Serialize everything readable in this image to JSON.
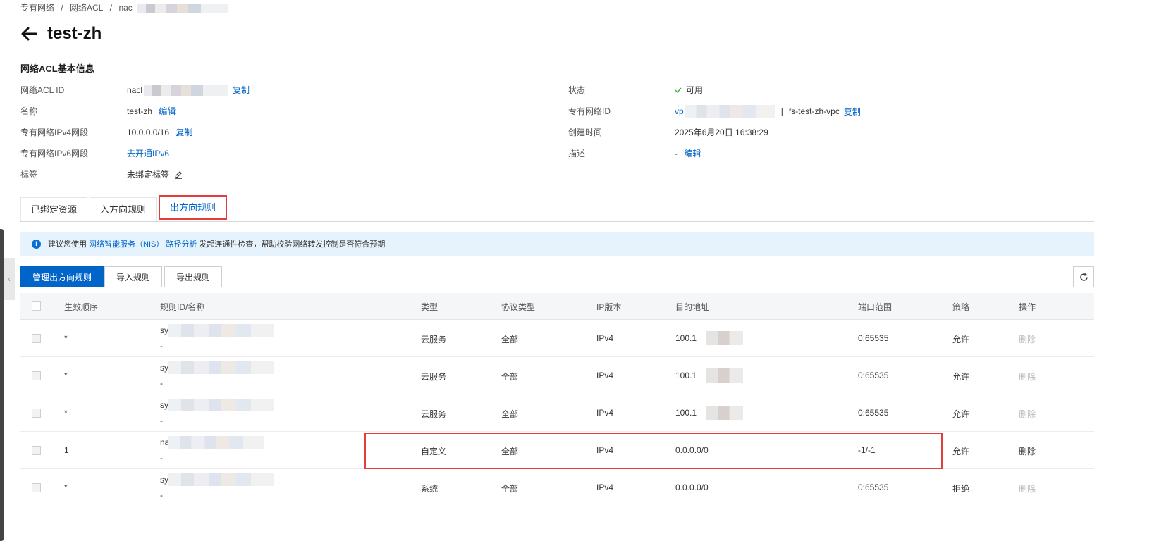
{
  "breadcrumb": [
    "专有网络",
    "/",
    "网络ACL",
    "/",
    "nac"
  ],
  "page_title": "test-zh",
  "section_title": "网络ACL基本信息",
  "left_info": [
    {
      "label": "网络ACL ID",
      "value": "nacl",
      "action": "复制"
    },
    {
      "label": "名称",
      "value": "test-zh",
      "action": "编辑"
    },
    {
      "label": "专有网络IPv4网段",
      "value": "10.0.0.0/16",
      "action": "复制"
    },
    {
      "label": "专有网络IPv6网段",
      "value": "",
      "action": "去开通IPv6"
    },
    {
      "label": "标签",
      "value": "未绑定标签",
      "action": ""
    }
  ],
  "right_info": {
    "status": {
      "label": "状态",
      "value": "可用"
    },
    "vpc": {
      "label": "专有网络ID",
      "value_prefix": "vp",
      "separator": "|",
      "value": "fs-test-zh-vpc",
      "action": "复制"
    },
    "created": {
      "label": "创建时间",
      "value": "2025年6月20日 16:38:29"
    },
    "desc": {
      "label": "描述",
      "value": "-",
      "action": "编辑"
    }
  },
  "tabs": [
    "已绑定资源",
    "入方向规则",
    "出方向规则"
  ],
  "notice": {
    "prefix": "建议您使用",
    "link1": "网络智能服务（NIS）",
    "link2": "路径分析",
    "suffix": "发起连通性检查，帮助校验网络转发控制是否符合预期"
  },
  "toolbar": {
    "manage": "管理出方向规则",
    "import": "导入规则",
    "export": "导出规则"
  },
  "columns": [
    "生效顺序",
    "规则ID/名称",
    "类型",
    "协议类型",
    "IP版本",
    "目的地址",
    "端口范围",
    "策略",
    "操作"
  ],
  "rows": [
    {
      "order": "*",
      "id": "sy",
      "name": "-",
      "type": "云服务",
      "protocol": "全部",
      "ip": "IPv4",
      "dest": "100.1(",
      "port": "0:65535",
      "policy": "允许",
      "op": "删除",
      "op_enabled": false
    },
    {
      "order": "*",
      "id": "sy",
      "name": "-",
      "type": "云服务",
      "protocol": "全部",
      "ip": "IPv4",
      "dest": "100.1(",
      "port": "0:65535",
      "policy": "允许",
      "op": "删除",
      "op_enabled": false
    },
    {
      "order": "*",
      "id": "sy",
      "name": "-",
      "type": "云服务",
      "protocol": "全部",
      "ip": "IPv4",
      "dest": "100.1(",
      "port": "0:65535",
      "policy": "允许",
      "op": "删除",
      "op_enabled": false
    },
    {
      "order": "1",
      "id": "na",
      "name": "-",
      "type": "自定义",
      "protocol": "全部",
      "ip": "IPv4",
      "dest": "0.0.0.0/0",
      "port": "-1/-1",
      "policy": "允许",
      "op": "删除",
      "op_enabled": true
    },
    {
      "order": "*",
      "id": "sy",
      "name": "-",
      "type": "系统",
      "protocol": "全部",
      "ip": "IPv4",
      "dest": "0.0.0.0/0",
      "port": "0:65535",
      "policy": "拒绝",
      "op": "删除",
      "op_enabled": false
    }
  ],
  "colors": {
    "link": "#0064c8",
    "highlight": "#e23c3c",
    "success": "#3db34a"
  }
}
